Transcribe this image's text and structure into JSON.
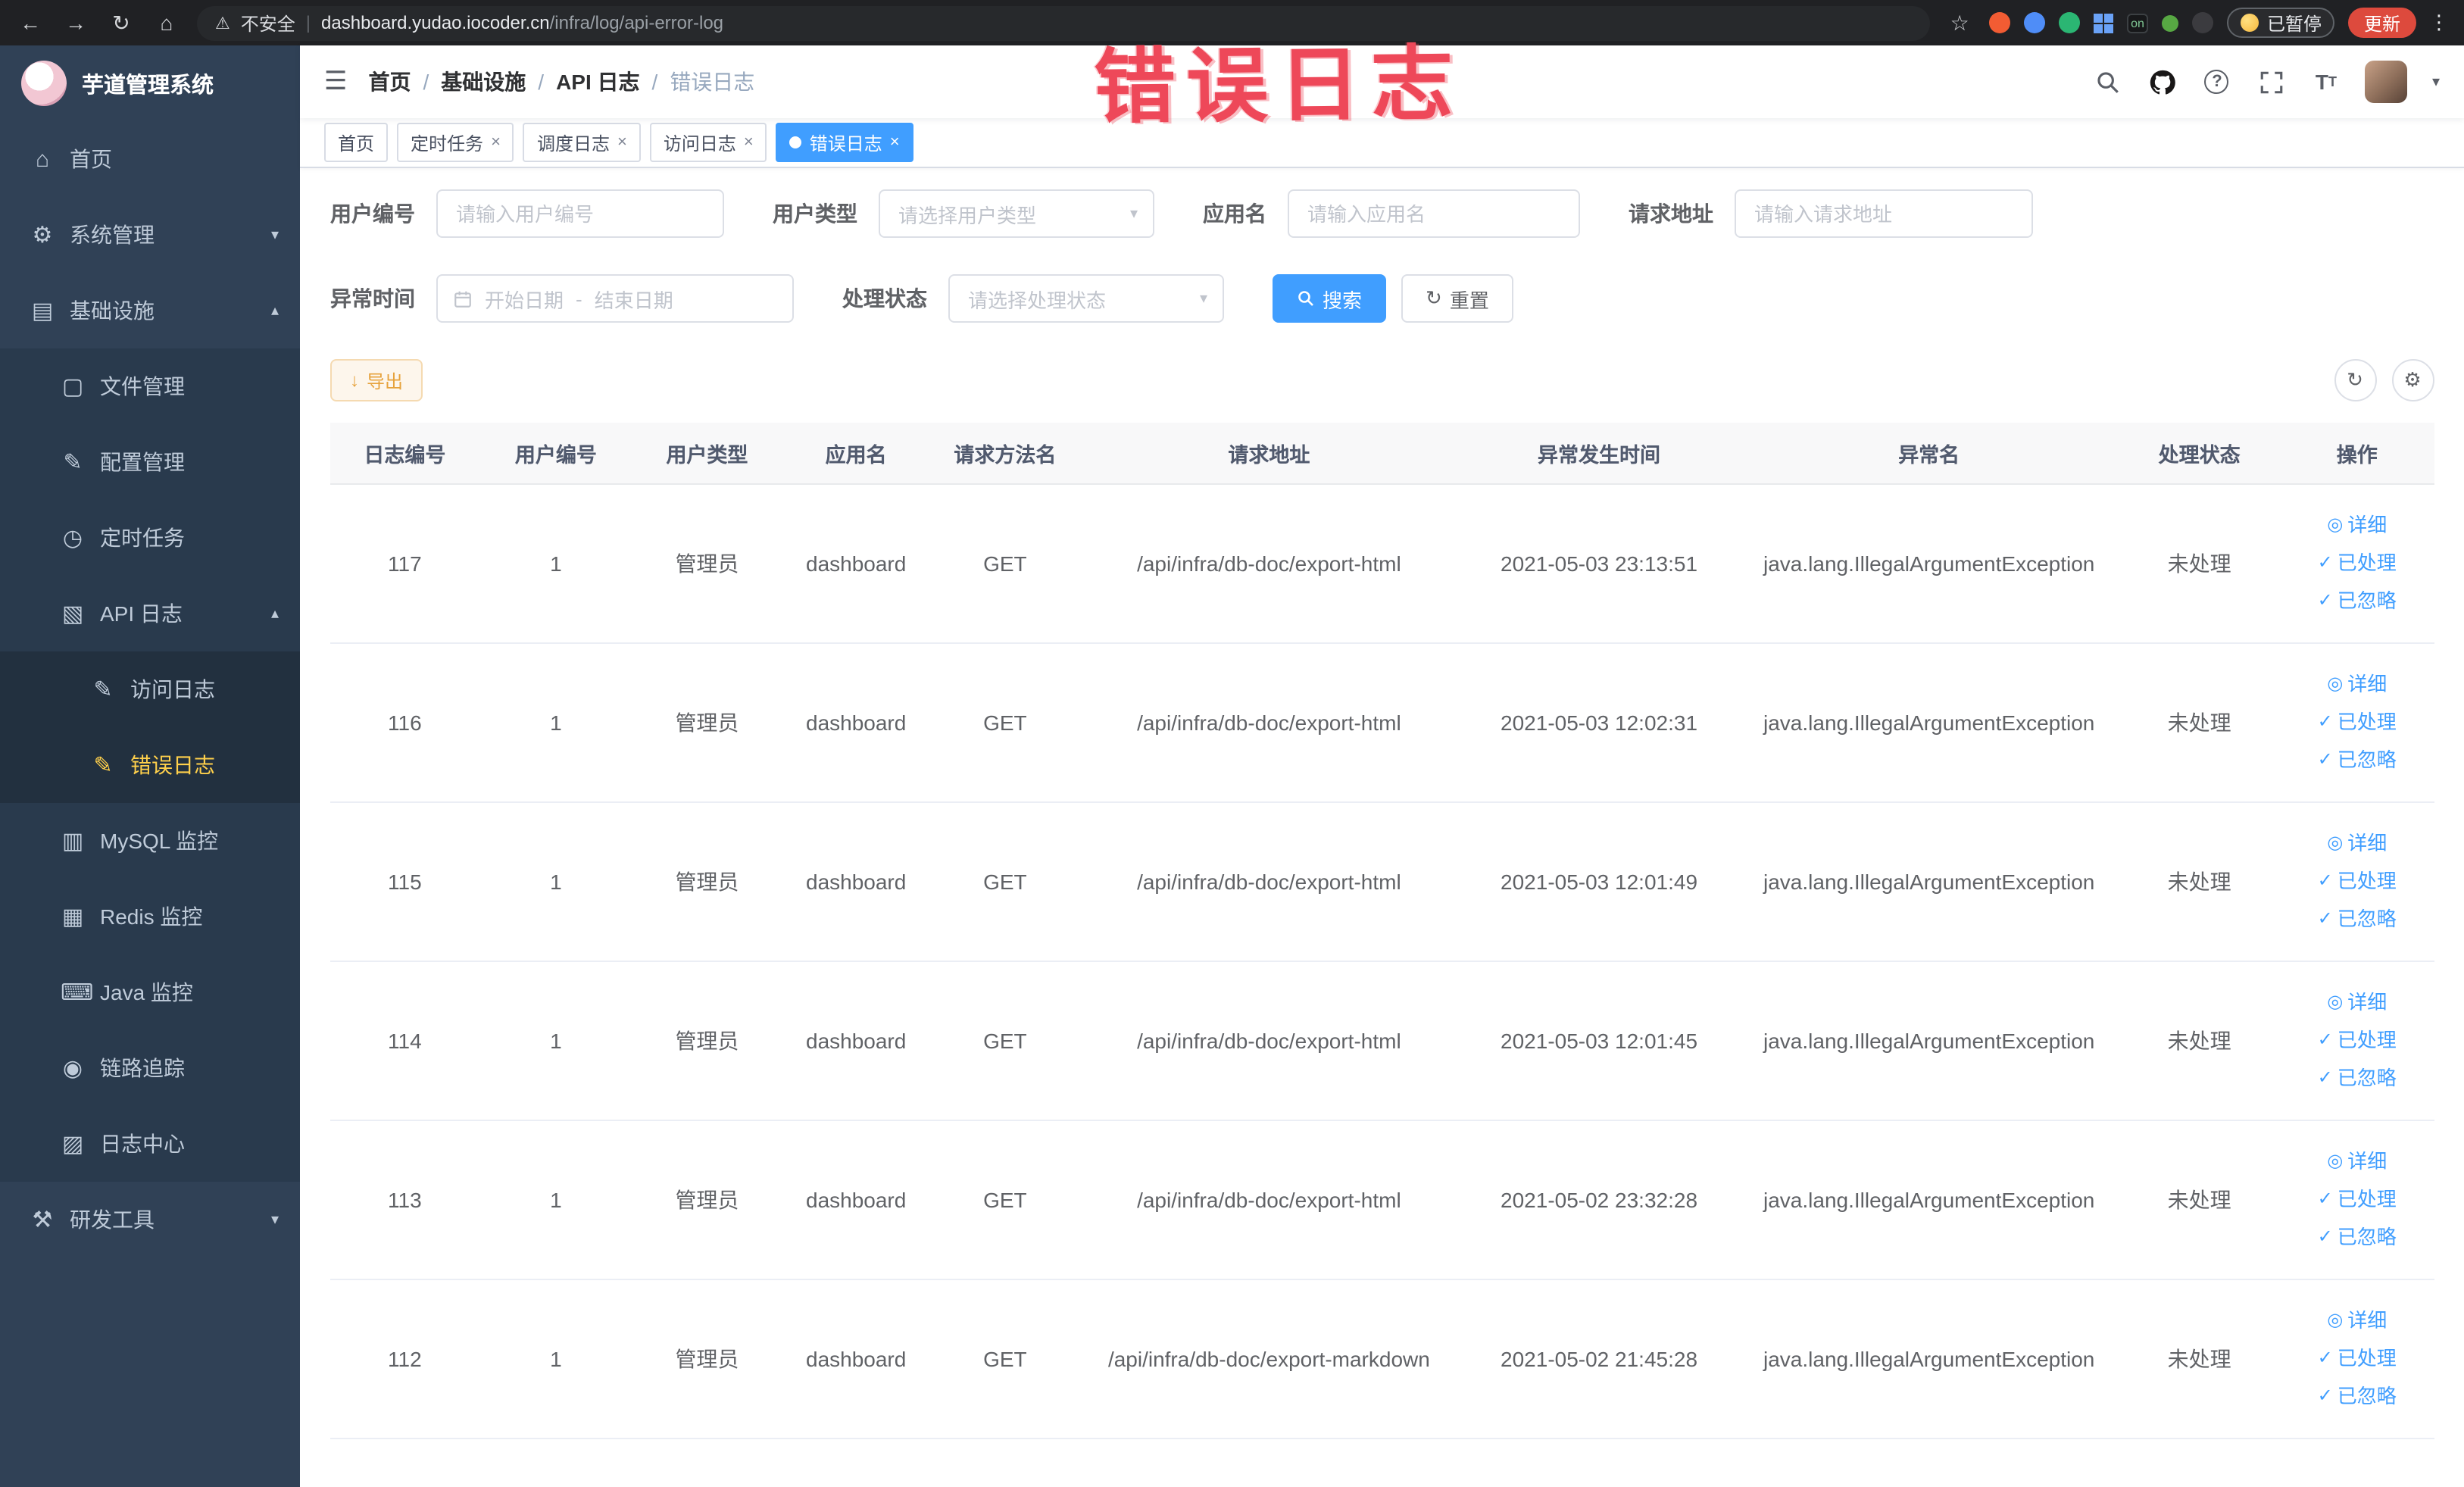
{
  "browser": {
    "security_label": "不安全",
    "url_domain": "dashboard.yudao.iocoder.cn",
    "url_path": "/infra/log/api-error-log",
    "on_badge": "on",
    "paused_label": "已暂停",
    "update_label": "更新"
  },
  "annotation": {
    "text": "错误日志"
  },
  "icons": {
    "back": "←",
    "forward": "→",
    "reload": "↻",
    "home_btn": "⌂",
    "warning": "⚠",
    "pipe": "|",
    "star": "☆",
    "kebab": "⋮",
    "home": "⌂",
    "gear": "⚙",
    "infra": "▤",
    "file": "▢",
    "config": "✎",
    "timer": "◷",
    "apilog": "▧",
    "doc": "✎",
    "mysql": "▥",
    "redis": "▦",
    "java": "⌨",
    "trace": "◉",
    "logcenter": "▨",
    "devtools": "⚒",
    "chevron_down": "▾",
    "chevron_up": "▴",
    "caret_down": "▾",
    "menu": "☰",
    "close": "×",
    "refresh": "↻",
    "download": "↓",
    "calendar": "▦",
    "eye": "◎",
    "check": "✓",
    "help": "?",
    "settings": "⚙",
    "fontsize_big": "T",
    "fontsize_small": "T"
  },
  "sidebar": {
    "logo_title": "芋道管理系统",
    "items": [
      {
        "label": "首页"
      },
      {
        "label": "系统管理"
      },
      {
        "label": "基础设施"
      },
      {
        "label": "文件管理"
      },
      {
        "label": "配置管理"
      },
      {
        "label": "定时任务"
      },
      {
        "label": "API 日志"
      },
      {
        "label": "访问日志"
      },
      {
        "label": "错误日志"
      },
      {
        "label": "MySQL 监控"
      },
      {
        "label": "Redis 监控"
      },
      {
        "label": "Java 监控"
      },
      {
        "label": "链路追踪"
      },
      {
        "label": "日志中心"
      },
      {
        "label": "研发工具"
      }
    ]
  },
  "header": {
    "breadcrumbs": [
      "首页",
      "基础设施",
      "API 日志",
      "错误日志"
    ],
    "separator": "/"
  },
  "tabs": [
    {
      "label": "首页"
    },
    {
      "label": "定时任务"
    },
    {
      "label": "调度日志"
    },
    {
      "label": "访问日志"
    },
    {
      "label": "错误日志"
    }
  ],
  "filters": {
    "user_id_label": "用户编号",
    "user_id_placeholder": "请输入用户编号",
    "user_type_label": "用户类型",
    "user_type_placeholder": "请选择用户类型",
    "app_name_label": "应用名",
    "app_name_placeholder": "请输入应用名",
    "request_url_label": "请求地址",
    "request_url_placeholder": "请输入请求地址",
    "exception_time_label": "异常时间",
    "date_start_placeholder": "开始日期",
    "date_separator": "-",
    "date_end_placeholder": "结束日期",
    "process_status_label": "处理状态",
    "process_status_placeholder": "请选择处理状态",
    "search_button": "搜索",
    "reset_button": "重置"
  },
  "toolbar": {
    "export_button": "导出"
  },
  "table": {
    "headers": [
      "日志编号",
      "用户编号",
      "用户类型",
      "应用名",
      "请求方法名",
      "请求地址",
      "异常发生时间",
      "异常名",
      "处理状态",
      "操作"
    ],
    "actions": {
      "detail": "详细",
      "processed": "已处理",
      "ignored": "已忽略"
    },
    "rows": [
      {
        "id": "117",
        "user_id": "1",
        "user_type": "管理员",
        "app": "dashboard",
        "method": "GET",
        "url": "/api/infra/db-doc/export-html",
        "time": "2021-05-03 23:13:51",
        "exception": "java.lang.IllegalArgumentException",
        "status": "未处理"
      },
      {
        "id": "116",
        "user_id": "1",
        "user_type": "管理员",
        "app": "dashboard",
        "method": "GET",
        "url": "/api/infra/db-doc/export-html",
        "time": "2021-05-03 12:02:31",
        "exception": "java.lang.IllegalArgumentException",
        "status": "未处理"
      },
      {
        "id": "115",
        "user_id": "1",
        "user_type": "管理员",
        "app": "dashboard",
        "method": "GET",
        "url": "/api/infra/db-doc/export-html",
        "time": "2021-05-03 12:01:49",
        "exception": "java.lang.IllegalArgumentException",
        "status": "未处理"
      },
      {
        "id": "114",
        "user_id": "1",
        "user_type": "管理员",
        "app": "dashboard",
        "method": "GET",
        "url": "/api/infra/db-doc/export-html",
        "time": "2021-05-03 12:01:45",
        "exception": "java.lang.IllegalArgumentException",
        "status": "未处理"
      },
      {
        "id": "113",
        "user_id": "1",
        "user_type": "管理员",
        "app": "dashboard",
        "method": "GET",
        "url": "/api/infra/db-doc/export-html",
        "time": "2021-05-02 23:32:28",
        "exception": "java.lang.IllegalArgumentException",
        "status": "未处理"
      },
      {
        "id": "112",
        "user_id": "1",
        "user_type": "管理员",
        "app": "dashboard",
        "method": "GET",
        "url": "/api/infra/db-doc/export-markdown",
        "time": "2021-05-02 21:45:28",
        "exception": "java.lang.IllegalArgumentException",
        "status": "未处理"
      }
    ]
  }
}
